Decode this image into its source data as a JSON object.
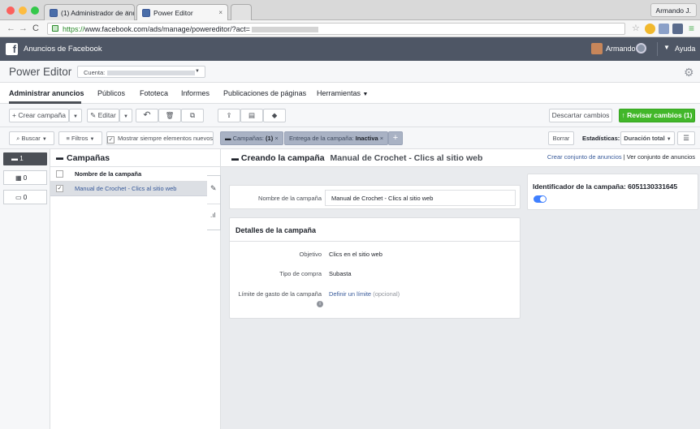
{
  "browser": {
    "tabs": [
      {
        "label": "(1) Administrador de anunc"
      },
      {
        "label": "Power Editor"
      }
    ],
    "user_chip": "Armando J.",
    "url_scheme": "https://",
    "url_rest": "www.facebook.com/ads/manage/powereditor/?act="
  },
  "fbbar": {
    "title": "Anuncios de Facebook",
    "user": "Armando",
    "help": "Ayuda"
  },
  "header": {
    "title": "Power Editor",
    "account_label": "Cuenta:"
  },
  "nav": {
    "tabs": [
      "Administrar anuncios",
      "Públicos",
      "Fototeca",
      "Informes",
      "Publicaciones de páginas",
      "Herramientas"
    ]
  },
  "toolbar": {
    "create": "+ Crear campaña",
    "edit": "Editar",
    "discard": "Descartar cambios",
    "review": "Revisar cambios (1)"
  },
  "filters": {
    "search": "Buscar",
    "filters": "Filtros",
    "show_always": "Mostrar siempre elementos nuevos",
    "chip1_label": "Campañas:",
    "chip1_value": "(1)",
    "chip2_label": "Entrega de la campaña:",
    "chip2_value": "Inactiva",
    "clear": "Borrar",
    "stats_label": "Estadísticas:",
    "stats_value": "Duración total"
  },
  "rail": {
    "campaigns_count": "1",
    "adsets_count": "0",
    "ads_count": "0"
  },
  "list": {
    "header": "Campañas",
    "column": "Nombre de la campaña",
    "row": "Manual de Crochet - Clics al sitio web"
  },
  "detail": {
    "creating": "Creando la campaña",
    "campaign_name": "Manual de Crochet - Clics al sitio web",
    "link_create": "Crear conjunto de anuncios",
    "link_sep": "|",
    "link_view": "Ver conjunto de anuncios",
    "name_label": "Nombre de la campaña",
    "name_value": "Manual de Crochet - Clics al sitio web",
    "section_title": "Detalles de la campaña",
    "objective_label": "Objetivo",
    "objective_value": "Clics en el sitio web",
    "buy_label": "Tipo de compra",
    "buy_value": "Subasta",
    "limit_label": "Límite de gasto de la campaña",
    "limit_link": "Definir un límite",
    "limit_optional": "(opcional)",
    "id_text": "Identificador de la campaña: 6051130331645"
  },
  "colors": {
    "fb_bar": "#4e5665",
    "review_green": "#42b72a",
    "link_blue": "#365899",
    "toggle_blue": "#4080ff"
  }
}
